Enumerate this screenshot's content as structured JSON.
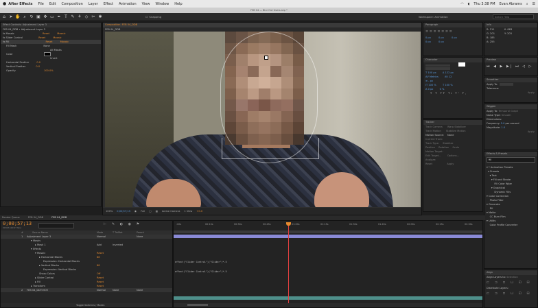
{
  "menubar": {
    "app_name": "After Effects",
    "menus": [
      "File",
      "Edit",
      "Composition",
      "Layer",
      "Effect",
      "Animation",
      "View",
      "Window",
      "Help"
    ],
    "clock": "Thu 3:38 PM",
    "user": "Evan Abrams"
  },
  "window_title": "FEB 04 — Blur Out Users.aep *",
  "toolbar": {
    "snapping_label": "Snapping"
  },
  "effect_controls": {
    "tab_label": "Effect Controls: Adjustment Layer 3",
    "breadcrumb": "FEB 04_DDB • Adjustment Layer 3",
    "rows": [
      {
        "name": "fx Mosaic",
        "value": "Reset",
        "extra": "Mosaic"
      },
      {
        "name": "fx Slider Control",
        "value": "Reset",
        "extra": "Mosaic"
      },
      {
        "name": "fx Fill",
        "value": "Reset",
        "extra": "Mosaic"
      },
      {
        "name": "Fill Mask",
        "value": "None"
      },
      {
        "name": "",
        "value": "All Masks"
      },
      {
        "name": "Color",
        "value": ""
      },
      {
        "name": "",
        "value": "Invert"
      },
      {
        "name": "Horizontal Feather",
        "value": "0.0"
      },
      {
        "name": "Vertical Feather",
        "value": "0.0"
      },
      {
        "name": "Opacity",
        "value": "100.0%"
      }
    ]
  },
  "composition": {
    "tab_label": "Composition: FEB 04_DDB",
    "subtab_label": "FEB 04_DDB",
    "footer": {
      "zoom": "100%",
      "timecode": "0;00;57;13",
      "resolution": "Full",
      "camera": "Active Camera",
      "views": "1 View",
      "exposure": "+0.0"
    }
  },
  "right_panels": {
    "workspace": "Workspace: Animation",
    "search_placeholder": "Search Help",
    "info": {
      "tab": "Info",
      "r": "R: 211",
      "g": "G: 201",
      "b": "B: 185",
      "a": "A: 255",
      "x": "X: 883",
      "y": "Y: 203"
    },
    "paragraph_tab": "Paragraph",
    "character_tab": "Character",
    "tracker": {
      "tab": "Tracker",
      "buttons": [
        "Track Camera",
        "Warp Stabilizer",
        "Track Motion",
        "Stabilize Motion"
      ],
      "motion_source_label": "Motion Source:",
      "motion_source": "None",
      "current_track_label": "Current Track:",
      "track_type_label": "Track Type:",
      "track_type": "Stabilize",
      "buttons2": [
        "Position",
        "Rotation",
        "Scale"
      ],
      "motion_target": "Motion Target:",
      "edit_target": "Edit Target...",
      "options": "Options...",
      "analyze": "Analyze:",
      "reset": "Reset",
      "apply": "Apply"
    },
    "preview_tab": "Preview",
    "smoother": {
      "tab": "Smoother",
      "apply_to": "Apply To:",
      "tolerance": "Tolerance:",
      "apply": "Apply"
    },
    "wiggler": {
      "tab": "Wiggler",
      "apply_to": "Apply To:",
      "apply_to_value": "Temporal Graph",
      "noise_type": "Noise Type:",
      "noise_value": "Smooth",
      "dimensions": "Dimensions:",
      "frequency": "Frequency:",
      "frequency_value": "5.0",
      "frequency_unit": "per second",
      "magnitude": "Magnitude:",
      "magnitude_value": "1.0",
      "apply": "Apply"
    },
    "effects_presets": {
      "tab": "Effects & Presets",
      "search_value": "fill",
      "tree": [
        "▾ * Animation Presets",
        "  ▾ Presets",
        "    ▾ Text",
        "      ▾ Fill and Stroke",
        "          Fill Color Wipe",
        "      ▾ Graphical",
        "          Dynamic Fills",
        "▾ Color Correction",
        "    Photo Filter",
        "▾ Generate",
        "    Fill",
        "▾ Matte",
        "    CC Burn Film",
        "▾ Utility",
        "    Color Profile Converter"
      ]
    },
    "align": {
      "tab": "Align",
      "align_layers_to": "Align Layers to:",
      "align_value": "Selection",
      "distribute": "Distribute Layers:"
    }
  },
  "project_tabs": [
    "Render Queue",
    "FEB 04_DDB",
    "FEB 04_DDB"
  ],
  "timeline": {
    "timecode": "0;00;57;13",
    "fps": "00343 (29.97 fps)",
    "search_placeholder": "",
    "columns": [
      "#",
      "Source Name",
      "Mode",
      "T TrkMat",
      "Parent"
    ],
    "rows": [
      {
        "num": "1",
        "name": "Adjustment Layer 3",
        "mode": "Normal",
        "trk": "",
        "parent": "None",
        "level": 0
      },
      {
        "num": "",
        "name": "▾ Masks",
        "level": 1
      },
      {
        "num": "",
        "name": "▸ Mask 1",
        "mode": "Add",
        "trk": "Inverted",
        "level": 2
      },
      {
        "num": "",
        "name": "▾ Effects",
        "level": 1
      },
      {
        "num": "",
        "name": "▾ Mosaic",
        "mode": "Reset",
        "level": 2
      },
      {
        "num": "",
        "name": "▸ Horizontal Blocks",
        "value": "88",
        "level": 3
      },
      {
        "num": "",
        "name": "Expression: Horizontal Blocks",
        "level": 4
      },
      {
        "num": "",
        "name": "▸ Vertical Blocks",
        "value": "88",
        "level": 3
      },
      {
        "num": "",
        "name": "Expression: Vertical Blocks",
        "level": 4
      },
      {
        "num": "",
        "name": "Sharp Colors",
        "value": "Off",
        "level": 3
      },
      {
        "num": "",
        "name": "▸ Slider Control",
        "mode": "Reset",
        "level": 2
      },
      {
        "num": "",
        "name": "▸ Fill",
        "mode": "Reset",
        "level": 2
      },
      {
        "num": "",
        "name": "▸ Transform",
        "mode": "Reset",
        "level": 1
      },
      {
        "num": "2",
        "name": "FEB 04_DDT.MOV",
        "mode": "Normal",
        "trk": "None",
        "parent": "None",
        "level": 0
      }
    ],
    "ruler_labels": [
      ":00s",
      "00:15s",
      "00:30s",
      "00:45s",
      "01:00s",
      "01:15s",
      "01:30s",
      "01:45s",
      "02:00s",
      "02:15s",
      "02:30s"
    ],
    "expressions": [
      "effect(\"Slider Control\")(\"Slider\")*.5",
      "effect(\"Slider Control\")(\"Slider\")*.5"
    ],
    "footer_toggle": "Toggle Switches / Modes"
  },
  "colors": {
    "accent": "#e48a2f",
    "blue": "#5a9be0",
    "track_purple": "#8a8ad6",
    "track_teal": "#4e8f8a",
    "playhead": "#e84040"
  }
}
